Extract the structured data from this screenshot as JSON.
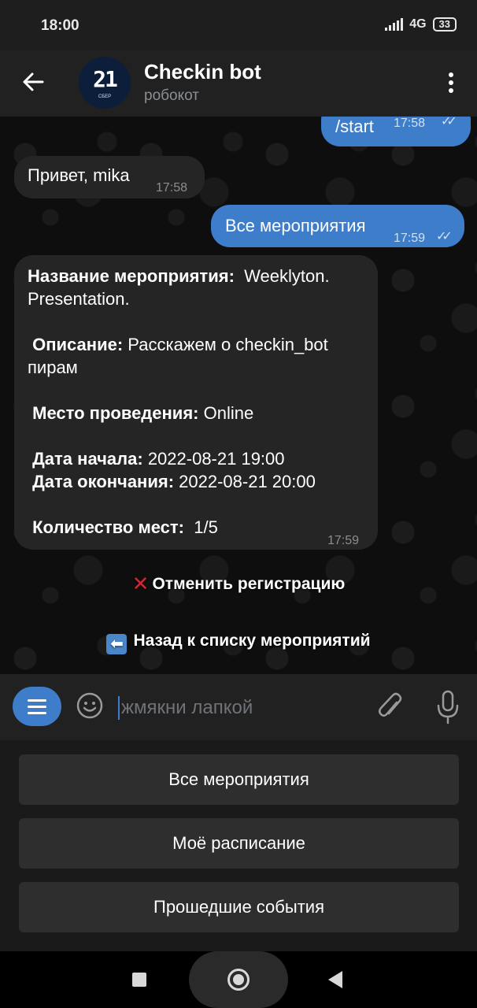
{
  "status_bar": {
    "time": "18:00",
    "network": "4G",
    "battery": "33"
  },
  "header": {
    "title": "Checkin bot",
    "subtitle": "робокот",
    "avatar_text": "21",
    "avatar_sub": "СБЕР"
  },
  "messages": [
    {
      "direction": "out",
      "text": "/start",
      "time": "17:58",
      "status": "read"
    },
    {
      "direction": "in",
      "text": "Привет, mika",
      "time": "17:58"
    },
    {
      "direction": "out",
      "text": "Все мероприятия",
      "time": "17:59",
      "status": "read"
    },
    {
      "direction": "in",
      "time": "17:59",
      "event": {
        "name_label": "Название мероприятия:",
        "name_value": "Weeklyton. Presentation.",
        "description_label": "Описание:",
        "description_value": "Расскажем о checkin_bot пирам",
        "location_label": "Место проведения:",
        "location_value": "Online",
        "start_label": "Дата начала:",
        "start_value": "2022-08-21 19:00",
        "end_label": "Дата окончания:",
        "end_value": "2022-08-21 20:00",
        "seats_label": "Количество мест:",
        "seats_value": "1/5"
      }
    }
  ],
  "inline_buttons": {
    "cancel_registration": "Отменить регистрацию",
    "back_to_list": "Назад к списку мероприятий"
  },
  "input": {
    "placeholder": "жмякни лапкой"
  },
  "keyboard": [
    "Все мероприятия",
    "Моё расписание",
    "Прошедшие события"
  ],
  "icons": {
    "back": "arrow-left-icon",
    "menu": "more-vertical-icon",
    "bot_menu": "menu-lines-icon",
    "emoji": "smile-icon",
    "attach": "paperclip-icon",
    "mic": "microphone-icon",
    "cancel": "cross-mark-icon",
    "back_list": "left-arrow-box-icon"
  },
  "colors": {
    "accent": "#3d7dca",
    "outgoing_bubble": "#3d7dca",
    "incoming_bubble": "#252525",
    "cross": "#e0202a"
  }
}
